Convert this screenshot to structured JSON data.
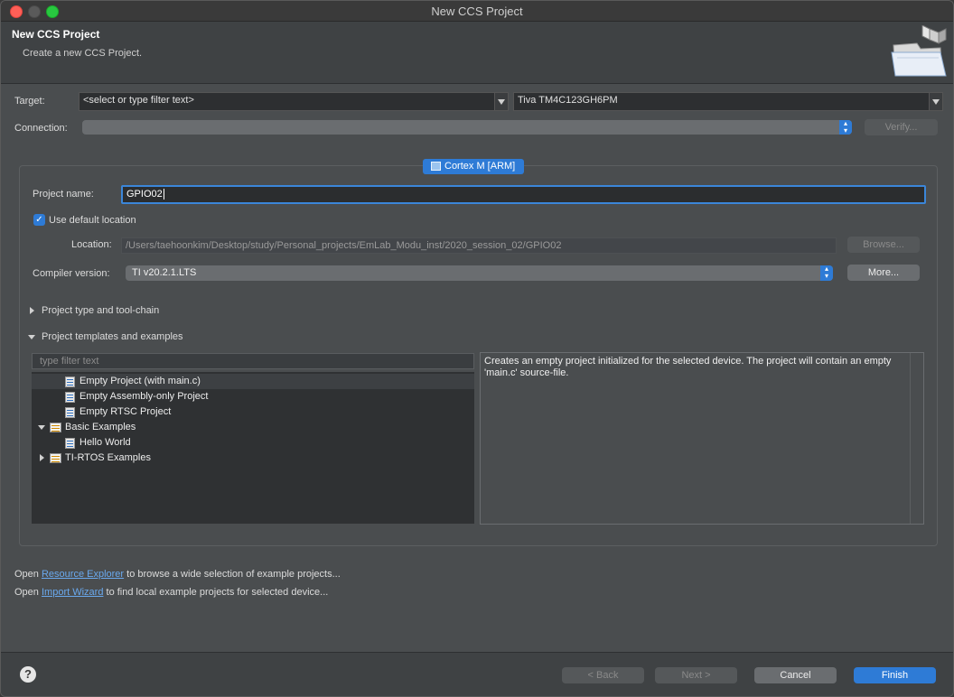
{
  "window": {
    "title": "New CCS Project"
  },
  "header": {
    "title": "New CCS Project",
    "subtitle": "Create a new CCS Project."
  },
  "target": {
    "label": "Target:",
    "filter_value": "<select or type filter text>",
    "device_value": "Tiva TM4C123GH6PM"
  },
  "connection": {
    "label": "Connection:",
    "value": "",
    "verify_label": "Verify..."
  },
  "core_tab": {
    "label": "Cortex M [ARM]"
  },
  "project": {
    "name_label": "Project name:",
    "name_value": "GPIO02",
    "use_default_label": "Use default location",
    "use_default_checked": true,
    "location_label": "Location:",
    "location_value": "/Users/taehoonkim/Desktop/study/Personal_projects/EmLab_Modu_inst/2020_session_02/GPIO02",
    "browse_label": "Browse...",
    "compiler_label": "Compiler version:",
    "compiler_value": "TI v20.2.1.LTS",
    "more_label": "More..."
  },
  "sections": {
    "toolchain": "Project type and tool-chain",
    "templates": "Project templates and examples"
  },
  "templates": {
    "filter_placeholder": "type filter text",
    "items": [
      {
        "label": "Empty Project (with main.c)",
        "icon": "file-icon",
        "selected": true
      },
      {
        "label": "Empty Assembly-only Project",
        "icon": "file-icon"
      },
      {
        "label": "Empty RTSC Project",
        "icon": "file-icon"
      },
      {
        "label": "Basic Examples",
        "icon": "folder-icon",
        "expanded": true
      },
      {
        "label": "Hello World",
        "icon": "file-icon"
      },
      {
        "label": "TI-RTOS Examples",
        "icon": "folder-icon",
        "expanded": false
      }
    ],
    "description": "Creates an empty project initialized for the selected device. The project will contain an empty 'main.c' source-file."
  },
  "links": {
    "line1_prefix": "Open",
    "line1_link": "Resource Explorer",
    "line1_suffix": "to browse a wide selection of example projects...",
    "line2_prefix": "Open",
    "line2_link": "Import Wizard",
    "line2_suffix": "to find local example projects for selected device..."
  },
  "buttons": {
    "back": "< Back",
    "next": "Next >",
    "cancel": "Cancel",
    "finish": "Finish",
    "help": "?"
  },
  "colors": {
    "accent": "#2e7bd6",
    "link": "#6aa9ee",
    "dialog_bg": "#4a4d4f"
  }
}
